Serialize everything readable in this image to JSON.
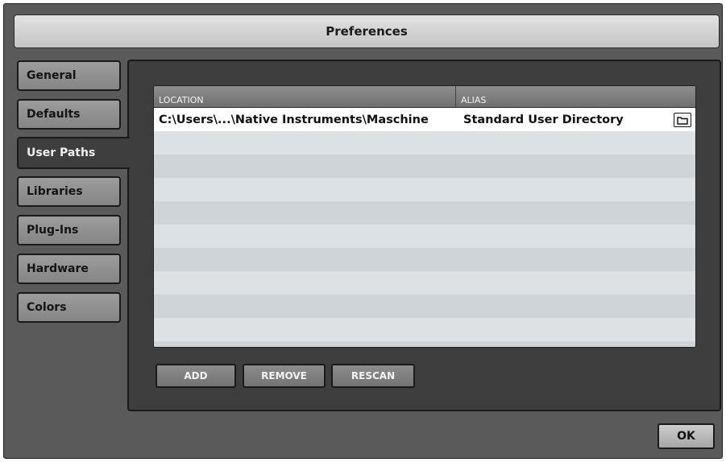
{
  "window": {
    "title": "Preferences"
  },
  "sidebar": {
    "tabs": [
      {
        "label": "General"
      },
      {
        "label": "Defaults"
      },
      {
        "label": "User Paths"
      },
      {
        "label": "Libraries"
      },
      {
        "label": "Plug-Ins"
      },
      {
        "label": "Hardware"
      },
      {
        "label": "Colors"
      }
    ],
    "active": "User Paths"
  },
  "table": {
    "columns": {
      "location": "LOCATION",
      "alias": "ALIAS"
    },
    "rows": [
      {
        "location": "C:\\Users\\...\\Native Instruments\\Maschine",
        "alias": "Standard User Directory",
        "icon": "folder-icon"
      }
    ]
  },
  "buttons": {
    "add": "ADD",
    "remove": "REMOVE",
    "rescan": "RESCAN",
    "ok": "OK"
  },
  "colors": {
    "window_bg": "#5a5a5a",
    "panel_bg": "#3e3e3e",
    "titlebar": "#d4d4d4",
    "row_selected": "#ffffff",
    "row_alt": "#cfd4d9"
  }
}
